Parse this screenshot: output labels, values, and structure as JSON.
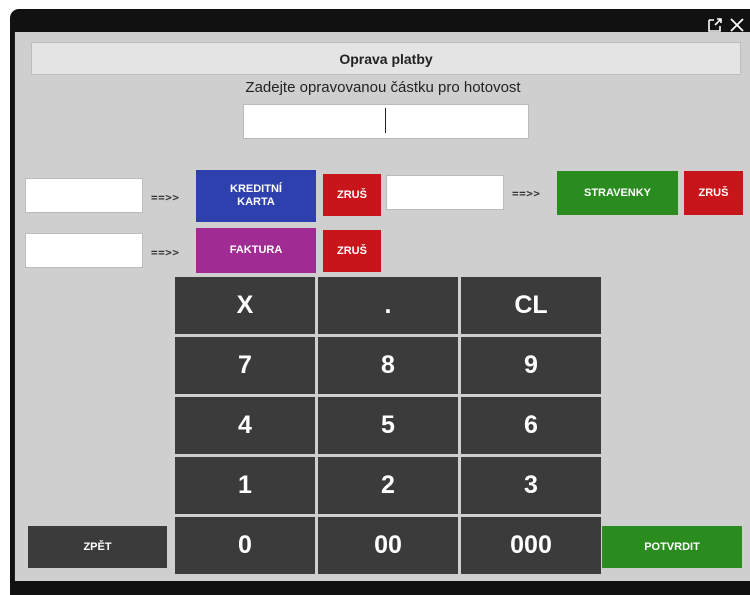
{
  "dialog": {
    "title": "Oprava platby",
    "instruction": "Zadejte opravovanou částku pro hotovost",
    "cash_value": ""
  },
  "payments": {
    "arrow": "==>>",
    "credit_card": {
      "label": "KREDITNÍ KARTA",
      "value": "",
      "cancel": "ZRUŠ"
    },
    "meal_voucher": {
      "label": "STRAVENKY",
      "value": "",
      "cancel": "ZRUŠ"
    },
    "invoice": {
      "label": "FAKTURA",
      "value": "",
      "cancel": "ZRUŠ"
    }
  },
  "keypad": {
    "keys": [
      "X",
      ".",
      "CL",
      "7",
      "8",
      "9",
      "4",
      "5",
      "6",
      "1",
      "2",
      "3",
      "0",
      "00",
      "000"
    ]
  },
  "actions": {
    "back": "ZPĚT",
    "confirm": "POTVRDIT"
  },
  "colors": {
    "card_blue": "#2e3fae",
    "invoice_purple": "#a02b93",
    "voucher_green": "#2a8c1f",
    "cancel_red": "#c8151b",
    "keypad_dark": "#3b3b3b"
  }
}
